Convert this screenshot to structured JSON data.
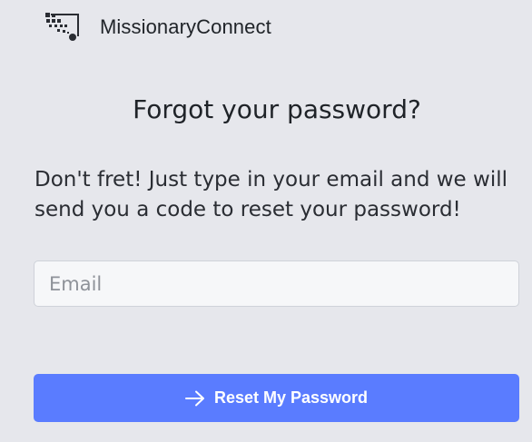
{
  "header": {
    "brand": "MissionaryConnect",
    "logo_icon": "dots-network-logo"
  },
  "main": {
    "title": "Forgot your password?",
    "subtitle": "Don't fret! Just type in your email and we will send you a code to reset your password!"
  },
  "form": {
    "email_placeholder": "Email",
    "email_value": "",
    "submit_label": "Reset My Password",
    "submit_icon": "arrow-right-icon"
  },
  "colors": {
    "background": "#e6e7ec",
    "accent": "#5a7cff",
    "text": "#1f2328"
  }
}
